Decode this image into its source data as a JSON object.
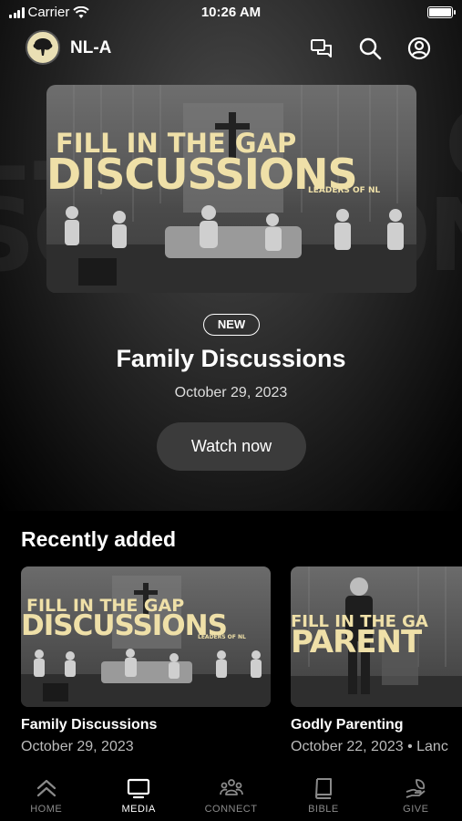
{
  "status_bar": {
    "carrier": "Carrier",
    "time": "10:26 AM"
  },
  "header": {
    "brand": "NL-A"
  },
  "hero": {
    "badge": "NEW",
    "title": "Family Discussions",
    "date": "October 29, 2023",
    "cta": "Watch now",
    "art_line1": "FILL IN THE GAP",
    "art_line2": "DISCUSSIONS",
    "art_line3": "LEADERS OF NL"
  },
  "recently_added": {
    "heading": "Recently added",
    "items": [
      {
        "title": "Family Discussions",
        "date": "October 29, 2023",
        "art_line1": "FILL IN THE GAP",
        "art_line2": "DISCUSSIONS",
        "art_line3": "LEADERS OF NL"
      },
      {
        "title": "Godly Parenting",
        "date": "October 22, 2023 • Lanc",
        "art_line1": "FILL IN THE GA",
        "art_line2": "PARENT"
      }
    ]
  },
  "tabs": [
    {
      "label": "HOME",
      "icon": "home-chevrons-icon",
      "active": false
    },
    {
      "label": "MEDIA",
      "icon": "tv-icon",
      "active": true
    },
    {
      "label": "CONNECT",
      "icon": "people-icon",
      "active": false
    },
    {
      "label": "BIBLE",
      "icon": "book-icon",
      "active": false
    },
    {
      "label": "GIVE",
      "icon": "leaf-hand-icon",
      "active": false
    }
  ]
}
